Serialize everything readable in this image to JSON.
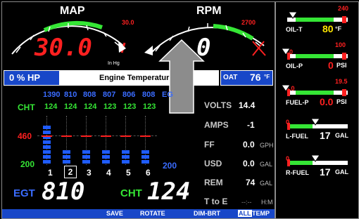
{
  "map": {
    "title": "MAP",
    "value": "30.0",
    "redline": "30.0",
    "unit": "In Hg"
  },
  "rpm": {
    "title": "RPM",
    "value": "0",
    "redline": "2700"
  },
  "bar": {
    "hp": "0 % HP",
    "center": "Engine Temperatures",
    "oat_label": "OAT",
    "oat_value": "76",
    "oat_unit": "°F"
  },
  "egt_values": [
    "1390",
    "810",
    "808",
    "807",
    "806",
    "808"
  ],
  "egt_trailing": "EG",
  "cht_label": "CHT",
  "cht_values": [
    "124",
    "124",
    "124",
    "123",
    "123",
    "123"
  ],
  "scale": {
    "top": "460",
    "bottom": "200",
    "right": "200"
  },
  "cyl_numbers": [
    "1",
    "2",
    "3",
    "4",
    "5",
    "6"
  ],
  "selected_cyl": "2",
  "bar_levels": [
    0.78,
    0.38,
    0.38,
    0.38,
    0.38,
    0.38
  ],
  "readouts": [
    {
      "label": "VOLTS",
      "value": "14.4",
      "unit": ""
    },
    {
      "label": "AMPS",
      "value": "-1",
      "unit": ""
    },
    {
      "label": "FF",
      "value": "0.0",
      "unit": "GPH"
    },
    {
      "label": "USD",
      "value": "0.0",
      "unit": "GAL"
    },
    {
      "label": "REM",
      "value": "74",
      "unit": "GAL"
    },
    {
      "label": "T to E",
      "value": "--:--",
      "unit": "H:M"
    }
  ],
  "big": {
    "egt_label": "EGT",
    "egt_value": "810",
    "cht_label": "CHT",
    "cht_value": "124"
  },
  "bottom": {
    "save": "SAVE",
    "rotate": "ROTATE",
    "dim": "DIM-BRT",
    "all": "ALL",
    "temp": "TEMP"
  },
  "right_gauges": [
    {
      "label": "OIL-T",
      "value": "80",
      "unit": "°F",
      "min": "",
      "max": "240",
      "value_color": "#ffe600"
    },
    {
      "label": "OIL-P",
      "value": "0",
      "unit": "PSI",
      "min": "10",
      "max": "100",
      "value_color": "#ff2020"
    },
    {
      "label": "FUEL-P",
      "value": "0.0",
      "unit": "PSI",
      "min": "3.0",
      "max": "19.5",
      "value_color": "#ff2020"
    },
    {
      "label": "L-FUEL",
      "value": "17",
      "unit": "GAL",
      "min": "0",
      "max": "",
      "value_color": "#ffffff"
    },
    {
      "label": "R-FUEL",
      "value": "17",
      "unit": "GAL",
      "min": "0",
      "max": "",
      "value_color": "#ffffff"
    }
  ],
  "colors": {
    "green": "#35e635",
    "red": "#ff2020",
    "blue": "#1847c8",
    "yellow": "#ffe600"
  }
}
